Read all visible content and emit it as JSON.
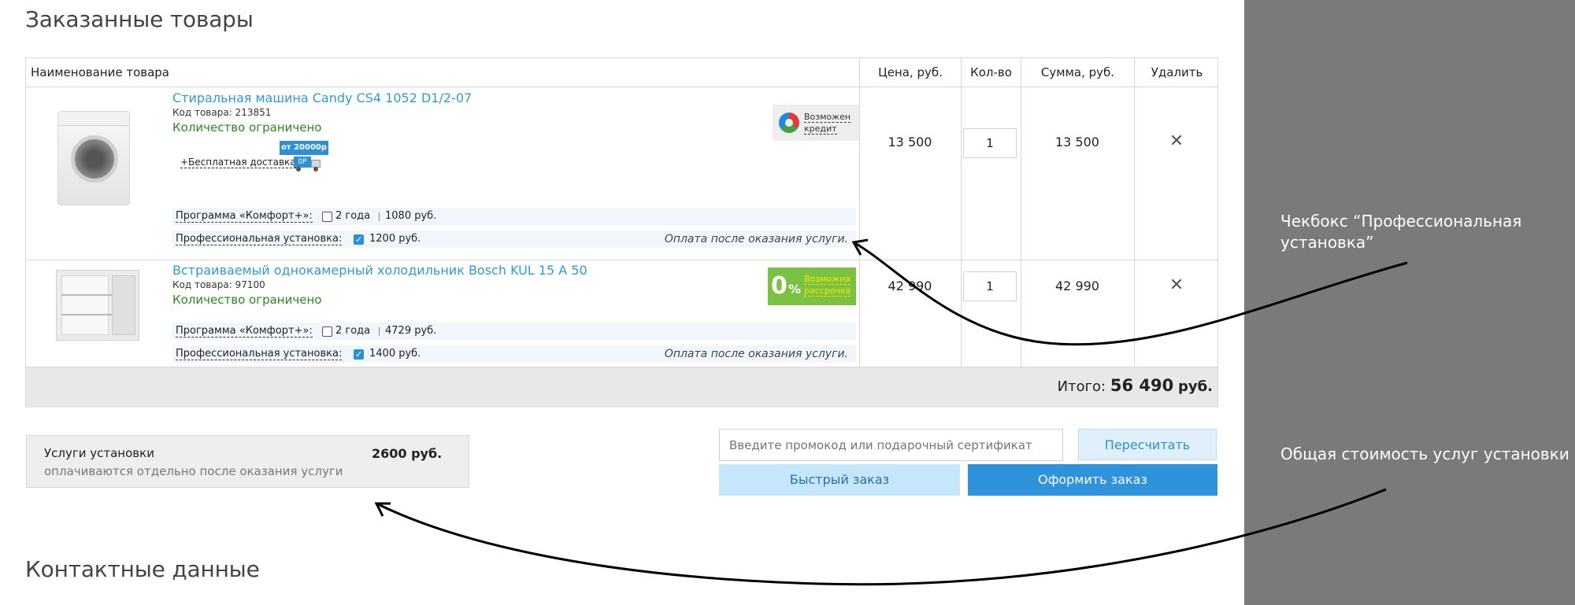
{
  "page": {
    "title": "Заказанные товары",
    "contacts_title": "Контактные данные"
  },
  "table": {
    "headers": {
      "name": "Наименование товара",
      "price": "Цена, руб.",
      "qty": "Кол-во",
      "sum": "Сумма, руб.",
      "delete": "Удалить"
    },
    "items": [
      {
        "title": "Стиральная машина Candy CS4 1052 D1/2-07",
        "code": "Код товара: 213851",
        "limited": "Количество ограничено",
        "delivery": "+Бесплатная доставка",
        "delivery_badge": "от 20000р",
        "truck_label": "0Р",
        "promo": [
          "Возможен",
          "кредит"
        ],
        "comfort_label": "Программа «Комфорт+»:",
        "comfort_years": "2 года",
        "comfort_price": "1080 руб.",
        "comfort_checked": false,
        "install_label": "Профессиональная установка:",
        "install_price": "1200 руб.",
        "install_checked": true,
        "install_note": "Оплата после оказания услуги.",
        "price": "13 500",
        "qty": "1",
        "sum": "13 500",
        "delete": "✕"
      },
      {
        "title": "Встраиваемый однокамерный холодильник Bosch KUL 15 A 50",
        "code": "Код товара: 97100",
        "limited": "Количество ограничено",
        "promo_zero": "0",
        "promo_pct": "%",
        "promo": [
          "Возможна",
          "рассрочка"
        ],
        "comfort_label": "Программа «Комфорт+»:",
        "comfort_years": "2 года",
        "comfort_price": "4729 руб.",
        "comfort_checked": false,
        "install_label": "Профессиональная установка:",
        "install_price": "1400 руб.",
        "install_checked": true,
        "install_note": "Оплата после оказания услуги.",
        "price": "42 990",
        "qty": "1",
        "sum": "42 990",
        "delete": "✕"
      }
    ],
    "total": {
      "label": "Итого:",
      "value": "56 490",
      "currency": "руб."
    }
  },
  "services": {
    "title": "Услуги установки",
    "subtitle": "оплачиваются отдельно после оказания услуги",
    "amount": "2600 руб."
  },
  "promo_input": {
    "placeholder": "Введите промокод или подарочный сертификат"
  },
  "buttons": {
    "recalc": "Пересчитать",
    "fast_order": "Быстрый заказ",
    "checkout": "Оформить заказ"
  },
  "annotations": {
    "checkbox_line1": "Чекбокс “Профессиональная",
    "checkbox_line2": "установка”",
    "total_services": "Общая стоимость услуг установки"
  },
  "colors": {
    "link": "#2f9ad6",
    "limited": "#2a8a1e",
    "primary_button": "#2f93dc",
    "sidebar": "#7a7a7a",
    "installment_badge": "#7cc242"
  }
}
